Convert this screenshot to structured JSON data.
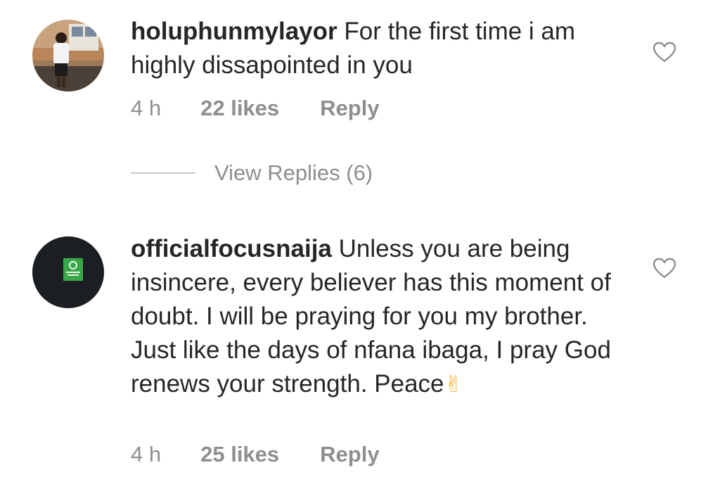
{
  "comments": [
    {
      "username": "holuphunmylayor",
      "text": "For the first time i am highly dissapointed in you",
      "time": "4 h",
      "likes": "22 likes",
      "reply_label": "Reply",
      "avatar_icon": "profile-photo-person",
      "like_icon": "heart-outline-icon"
    },
    {
      "username": "officialfocusnaija",
      "text": "Unless you are being insincere, every believer has this moment of doubt. I will be praying for you my brother. Just like the days of nfana ibaga, I pray God renews your strength. Peace",
      "emoji": "✌",
      "time": "4 h",
      "likes": "25 likes",
      "reply_label": "Reply",
      "avatar_icon": "profile-photo-logo",
      "like_icon": "heart-outline-icon"
    }
  ],
  "view_replies": {
    "label": "View Replies (6)"
  },
  "colors": {
    "text_primary": "#262626",
    "text_secondary": "#8e8e8e",
    "divider": "#c7c7c7",
    "background": "#ffffff"
  }
}
